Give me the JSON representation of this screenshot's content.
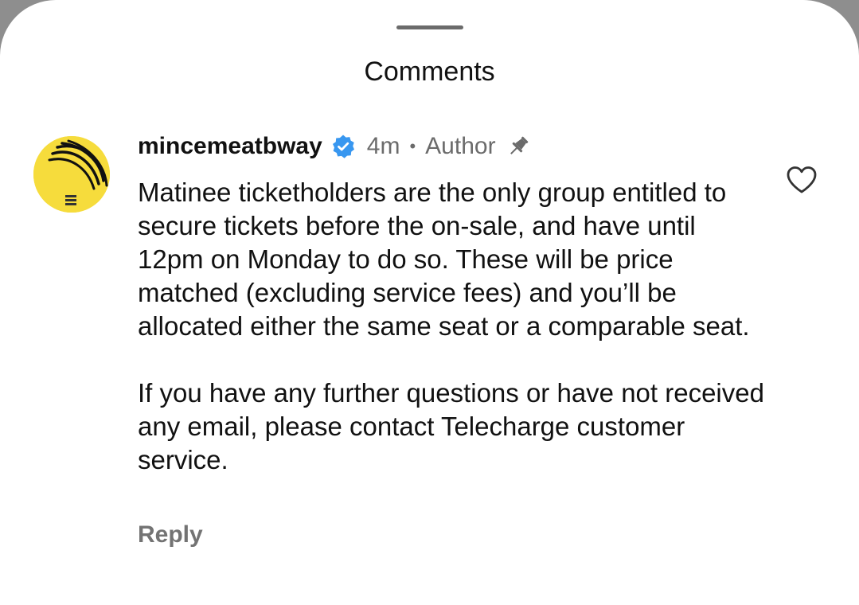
{
  "sheet": {
    "title": "Comments"
  },
  "comment": {
    "avatar_icon": "poster-avatar-icon",
    "username": "mincemeatbway",
    "verified_icon": "verified-badge-icon",
    "time": "4m",
    "separator": "•",
    "role": "Author",
    "pin_icon": "pin-icon",
    "paragraphs": [
      "Matinee ticketholders are the only group entitled to secure tickets before the on-sale, and have until 12pm on Monday to do so. These will be price matched (excluding service fees) and you’ll be allocated either the same seat or a comparable seat.",
      "If you have any further questions or have not received any email, please contact Telecharge customer service."
    ],
    "like_icon": "heart-icon",
    "reply_label": "Reply"
  },
  "colors": {
    "avatar_background": "#f6dc3c",
    "verified_badge": "#3897f0",
    "secondary_text": "#6b6b6b"
  }
}
